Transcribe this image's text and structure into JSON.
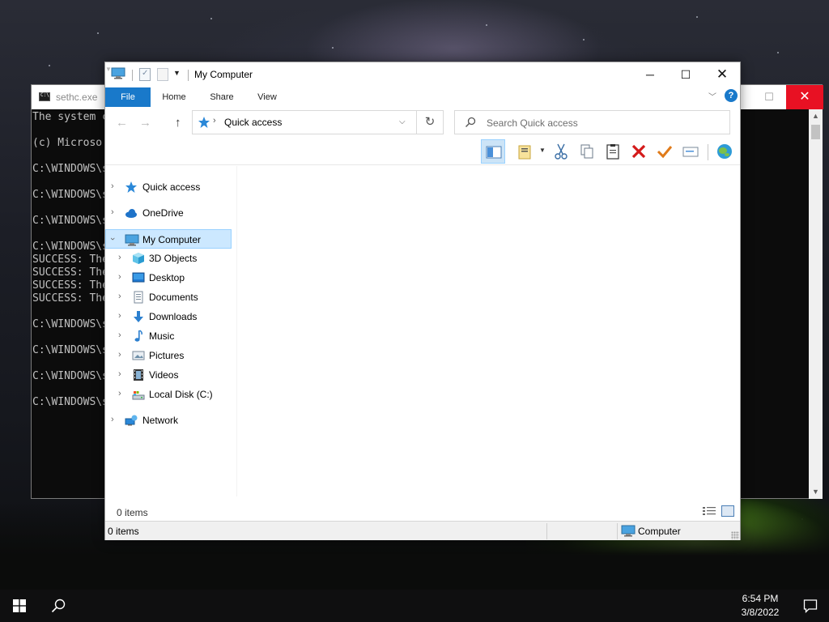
{
  "console": {
    "title": "sethc.exe",
    "lines": [
      "The system c",
      "",
      "(c) Microso",
      "",
      "C:\\WINDOWS\\s",
      "",
      "C:\\WINDOWS\\s",
      "",
      "C:\\WINDOWS\\s",
      "",
      "C:\\WINDOWS\\s",
      "SUCCESS: The",
      "SUCCESS: The",
      "SUCCESS: The",
      "SUCCESS: The",
      "",
      "C:\\WINDOWS\\s",
      "",
      "C:\\WINDOWS\\s",
      "",
      "C:\\WINDOWS\\s",
      "",
      "C:\\WINDOWS\\s"
    ],
    "close_icon": "close-icon",
    "maximize_icon": "maximize-icon"
  },
  "explorer": {
    "title": "My Computer",
    "window_buttons": {
      "minimize": "─",
      "maximize": "☐",
      "close": "✕"
    },
    "ribbon": {
      "tabs": [
        "File",
        "Home",
        "Share",
        "View"
      ],
      "help_label": "?"
    },
    "address": {
      "location": "Quick access",
      "separator": "›"
    },
    "search": {
      "placeholder": "Search Quick access"
    },
    "toolbar_icons": [
      "preview-pane-icon",
      "properties-icon",
      "cut-icon",
      "copy-icon",
      "paste-icon",
      "delete-icon",
      "apply-icon",
      "rename-icon",
      "globe-icon"
    ],
    "nav_pane": {
      "items": [
        {
          "label": "Quick access",
          "icon": "quick-access-star-icon"
        },
        {
          "label": "OneDrive",
          "icon": "onedrive-cloud-icon"
        },
        {
          "label": "My Computer",
          "icon": "computer-icon"
        },
        {
          "label": "3D Objects",
          "icon": "3d-objects-icon"
        },
        {
          "label": "Desktop",
          "icon": "desktop-icon"
        },
        {
          "label": "Documents",
          "icon": "documents-icon"
        },
        {
          "label": "Downloads",
          "icon": "downloads-icon"
        },
        {
          "label": "Music",
          "icon": "music-icon"
        },
        {
          "label": "Pictures",
          "icon": "pictures-icon"
        },
        {
          "label": "Videos",
          "icon": "videos-icon"
        },
        {
          "label": "Local Disk (C:)",
          "icon": "local-disk-icon"
        },
        {
          "label": "Network",
          "icon": "network-icon"
        }
      ],
      "selected": "My Computer"
    },
    "status": {
      "items_inner": "0 items",
      "items_bar": "0 items",
      "location_label": "Computer"
    },
    "colors": {
      "accent": "#1979ca",
      "selection": "#cce8ff"
    }
  },
  "taskbar": {
    "time": "6:54 PM",
    "date": "3/8/2022"
  }
}
